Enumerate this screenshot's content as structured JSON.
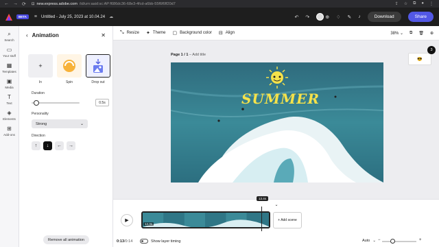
{
  "browser": {
    "url_domain": "new.express.adobe.com",
    "url_path": "/id/urn:aaid:sc:AP:f686dc36-68e3-4fcd-a6bb-55f6f6ff20d7",
    "nav_back": "←",
    "nav_forward": "→",
    "nav_reload": "⟳"
  },
  "header": {
    "beta_label": "BETA",
    "doc_title": "Untitled - July 25, 2023 at 10.04.24",
    "download_label": "Download",
    "share_label": "Share"
  },
  "rail": {
    "items": [
      {
        "label": "Search",
        "icon": "⌕"
      },
      {
        "label": "Your stuff",
        "icon": "▭"
      },
      {
        "label": "Templates",
        "icon": "▦"
      },
      {
        "label": "Media",
        "icon": "▣"
      },
      {
        "label": "Text",
        "icon": "T"
      },
      {
        "label": "Elements",
        "icon": "◈"
      },
      {
        "label": "Add-ons",
        "icon": "⊞"
      }
    ]
  },
  "panel": {
    "title": "Animation",
    "options": [
      {
        "label": "In",
        "icon": "+"
      },
      {
        "label": "Spin",
        "icon": "◔"
      },
      {
        "label": "Drop out",
        "icon": "↓"
      }
    ],
    "duration_label": "Duration",
    "duration_value": "0.5s",
    "personality_label": "Personality",
    "personality_value": "Strong",
    "direction_label": "Direction",
    "remove_label": "Remove all animation"
  },
  "toolbar": {
    "resize_label": "Resize",
    "theme_label": "Theme",
    "bg_color_label": "Background color",
    "align_label": "Align",
    "zoom_value": "38%"
  },
  "canvas": {
    "page_label": "Page 1 / 1",
    "add_title": "Add title",
    "headline": "SUMMER",
    "page_count": "3"
  },
  "timeline": {
    "playhead_time": "13.4s",
    "clip_duration": "14.3s",
    "add_scene_label": "+ Add scene",
    "current_time": "0:13",
    "total_time": "/0:14",
    "layer_timing_label": "Show layer timing",
    "auto_label": "Auto"
  },
  "colors": {
    "accent": "#5258e4",
    "header_bg": "#1e1e1e",
    "headline_yellow": "#f5e24a"
  }
}
